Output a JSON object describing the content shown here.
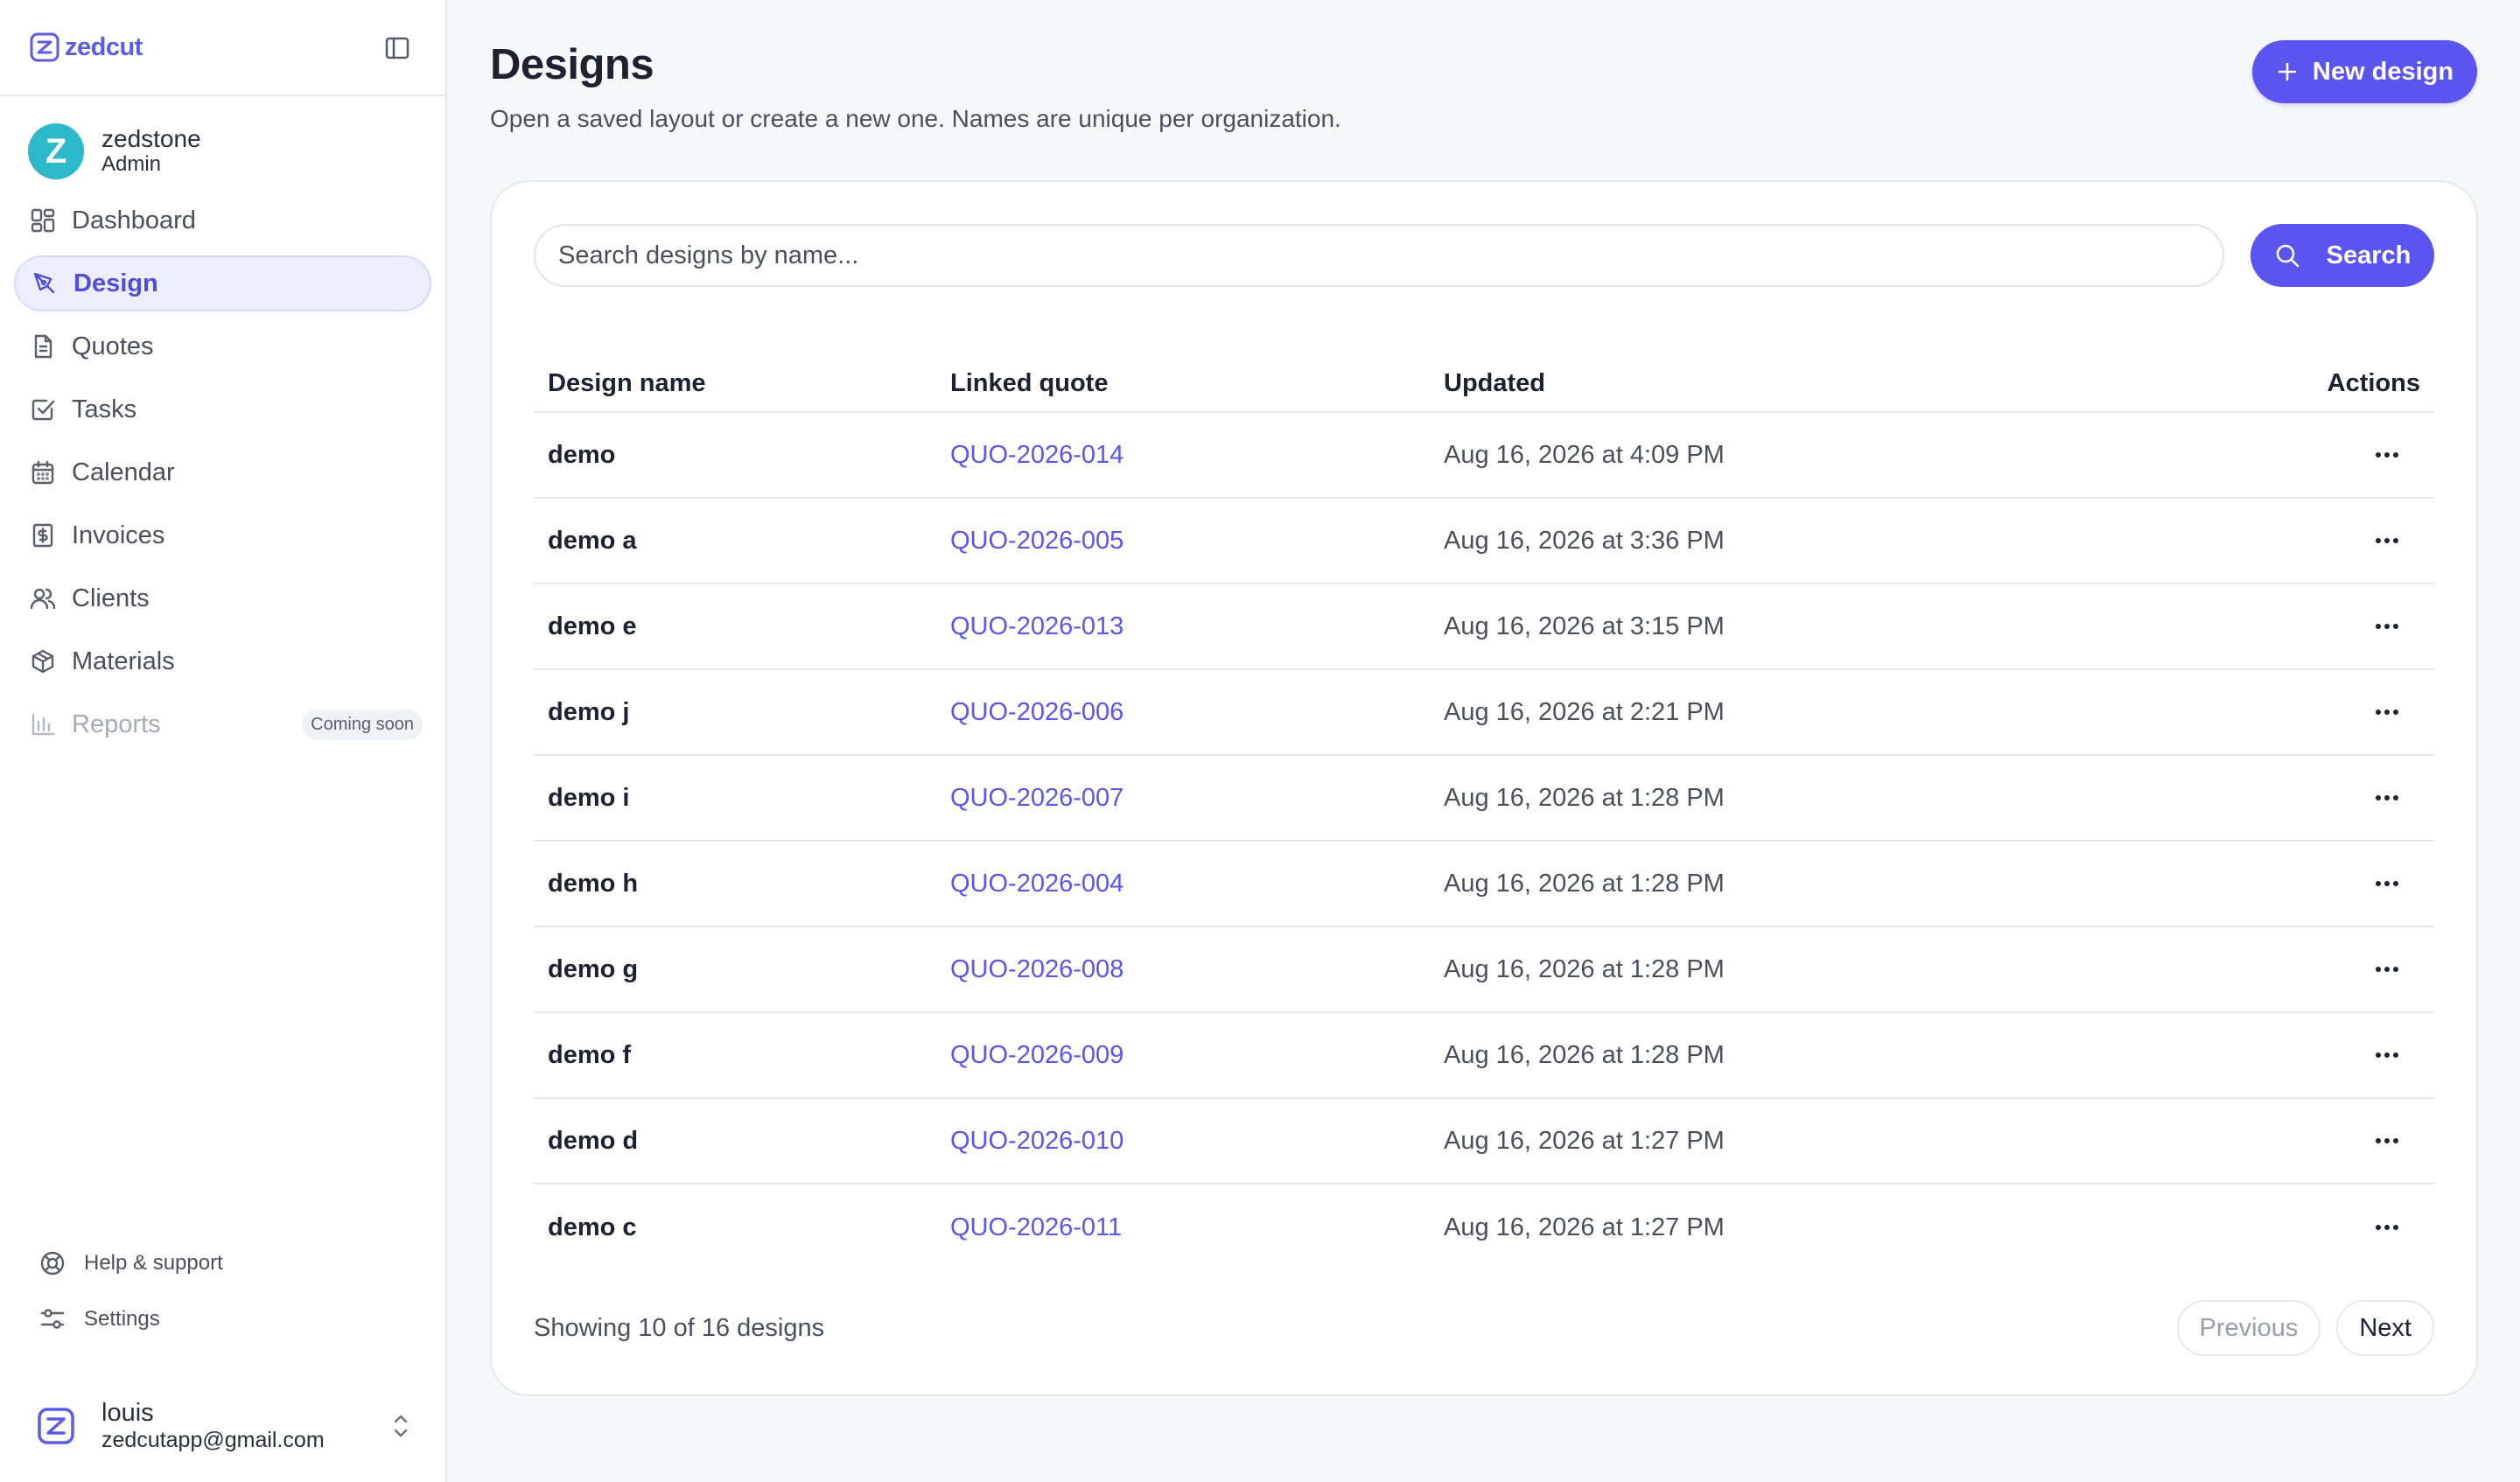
{
  "app": {
    "name": "zedcut"
  },
  "org": {
    "name": "zedstone",
    "role": "Admin",
    "avatar_letter": "Z",
    "avatar_color": "#2cb9c9"
  },
  "nav": {
    "dashboard": "Dashboard",
    "design": "Design",
    "quotes": "Quotes",
    "tasks": "Tasks",
    "calendar": "Calendar",
    "invoices": "Invoices",
    "clients": "Clients",
    "materials": "Materials",
    "reports": "Reports",
    "reports_badge": "Coming soon"
  },
  "utility": {
    "help": "Help & support",
    "settings": "Settings"
  },
  "user": {
    "name": "louis",
    "email": "zedcutapp@gmail.com"
  },
  "page": {
    "title": "Designs",
    "subtitle": "Open a saved layout or create a new one. Names are unique per organization.",
    "new_button": "New design"
  },
  "search": {
    "placeholder": "Search designs by name...",
    "value": "",
    "button": "Search"
  },
  "table": {
    "headers": {
      "name": "Design name",
      "quote": "Linked quote",
      "updated": "Updated",
      "actions": "Actions"
    },
    "rows": [
      {
        "name": "demo",
        "quote": "QUO-2026-014",
        "updated": "Aug 16, 2026 at 4:09 PM"
      },
      {
        "name": "demo a",
        "quote": "QUO-2026-005",
        "updated": "Aug 16, 2026 at 3:36 PM"
      },
      {
        "name": "demo e",
        "quote": "QUO-2026-013",
        "updated": "Aug 16, 2026 at 3:15 PM"
      },
      {
        "name": "demo j",
        "quote": "QUO-2026-006",
        "updated": "Aug 16, 2026 at 2:21 PM"
      },
      {
        "name": "demo i",
        "quote": "QUO-2026-007",
        "updated": "Aug 16, 2026 at 1:28 PM"
      },
      {
        "name": "demo h",
        "quote": "QUO-2026-004",
        "updated": "Aug 16, 2026 at 1:28 PM"
      },
      {
        "name": "demo g",
        "quote": "QUO-2026-008",
        "updated": "Aug 16, 2026 at 1:28 PM"
      },
      {
        "name": "demo f",
        "quote": "QUO-2026-009",
        "updated": "Aug 16, 2026 at 1:28 PM"
      },
      {
        "name": "demo d",
        "quote": "QUO-2026-010",
        "updated": "Aug 16, 2026 at 1:27 PM"
      },
      {
        "name": "demo c",
        "quote": "QUO-2026-011",
        "updated": "Aug 16, 2026 at 1:27 PM"
      }
    ]
  },
  "pagination": {
    "summary": "Showing 10 of 16 designs",
    "previous": "Previous",
    "next": "Next"
  },
  "colors": {
    "accent": "#5b55f0",
    "link": "#5b55e8",
    "active_bg": "#eceefc"
  }
}
